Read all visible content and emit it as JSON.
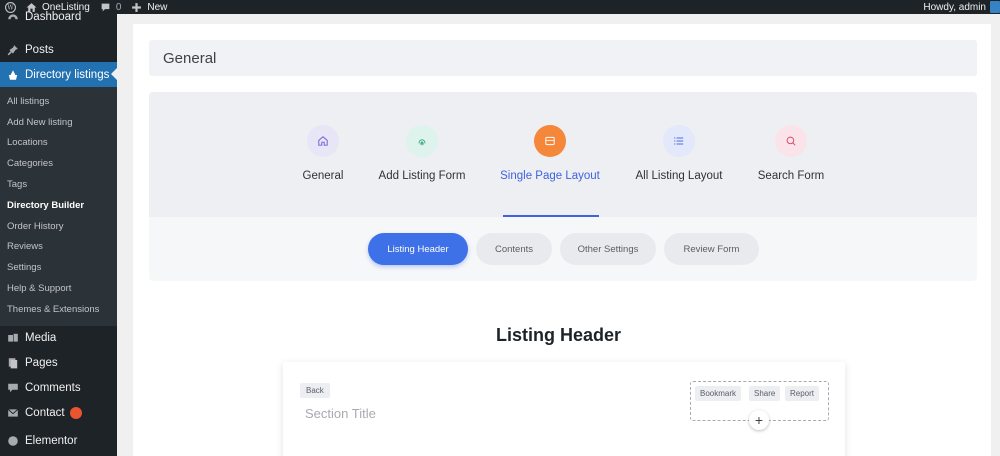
{
  "adminbar": {
    "site_name": "OneListing",
    "comments_count": "0",
    "new_label": "New",
    "howdy": "Howdy, admin"
  },
  "sidebar": {
    "dashboard": "Dashboard",
    "posts": "Posts",
    "directory": "Directory listings",
    "submenu": [
      "All listings",
      "Add New listing",
      "Locations",
      "Categories",
      "Tags",
      "Directory Builder",
      "Order History",
      "Reviews",
      "Settings",
      "Help & Support",
      "Themes & Extensions"
    ],
    "media": "Media",
    "pages": "Pages",
    "comments": "Comments",
    "contact": "Contact",
    "elementor": "Elementor"
  },
  "page": {
    "title": "General"
  },
  "nav_tabs": [
    {
      "label": "General",
      "icon": "home-icon",
      "color": "#e8e6f6"
    },
    {
      "label": "Add Listing Form",
      "icon": "fingerprint-icon",
      "color": "#ddf3ec"
    },
    {
      "label": "Single Page Layout",
      "icon": "layout-icon",
      "color": "#f5873a"
    },
    {
      "label": "All Listing Layout",
      "icon": "list-icon",
      "color": "#e3e8fb"
    },
    {
      "label": "Search Form",
      "icon": "search-icon",
      "color": "#fbe3ea"
    }
  ],
  "sub_tabs": [
    "Listing Header",
    "Contents",
    "Other Settings",
    "Review Form"
  ],
  "builder": {
    "heading": "Listing Header",
    "back_label": "Back",
    "section_title": "Section Title",
    "actions": [
      "Bookmark",
      "Share",
      "Report"
    ],
    "add_label": "+"
  },
  "colors": {
    "accent": "#3e62e0",
    "admin_dark": "#1d2327",
    "active_menu": "#2271b1"
  }
}
